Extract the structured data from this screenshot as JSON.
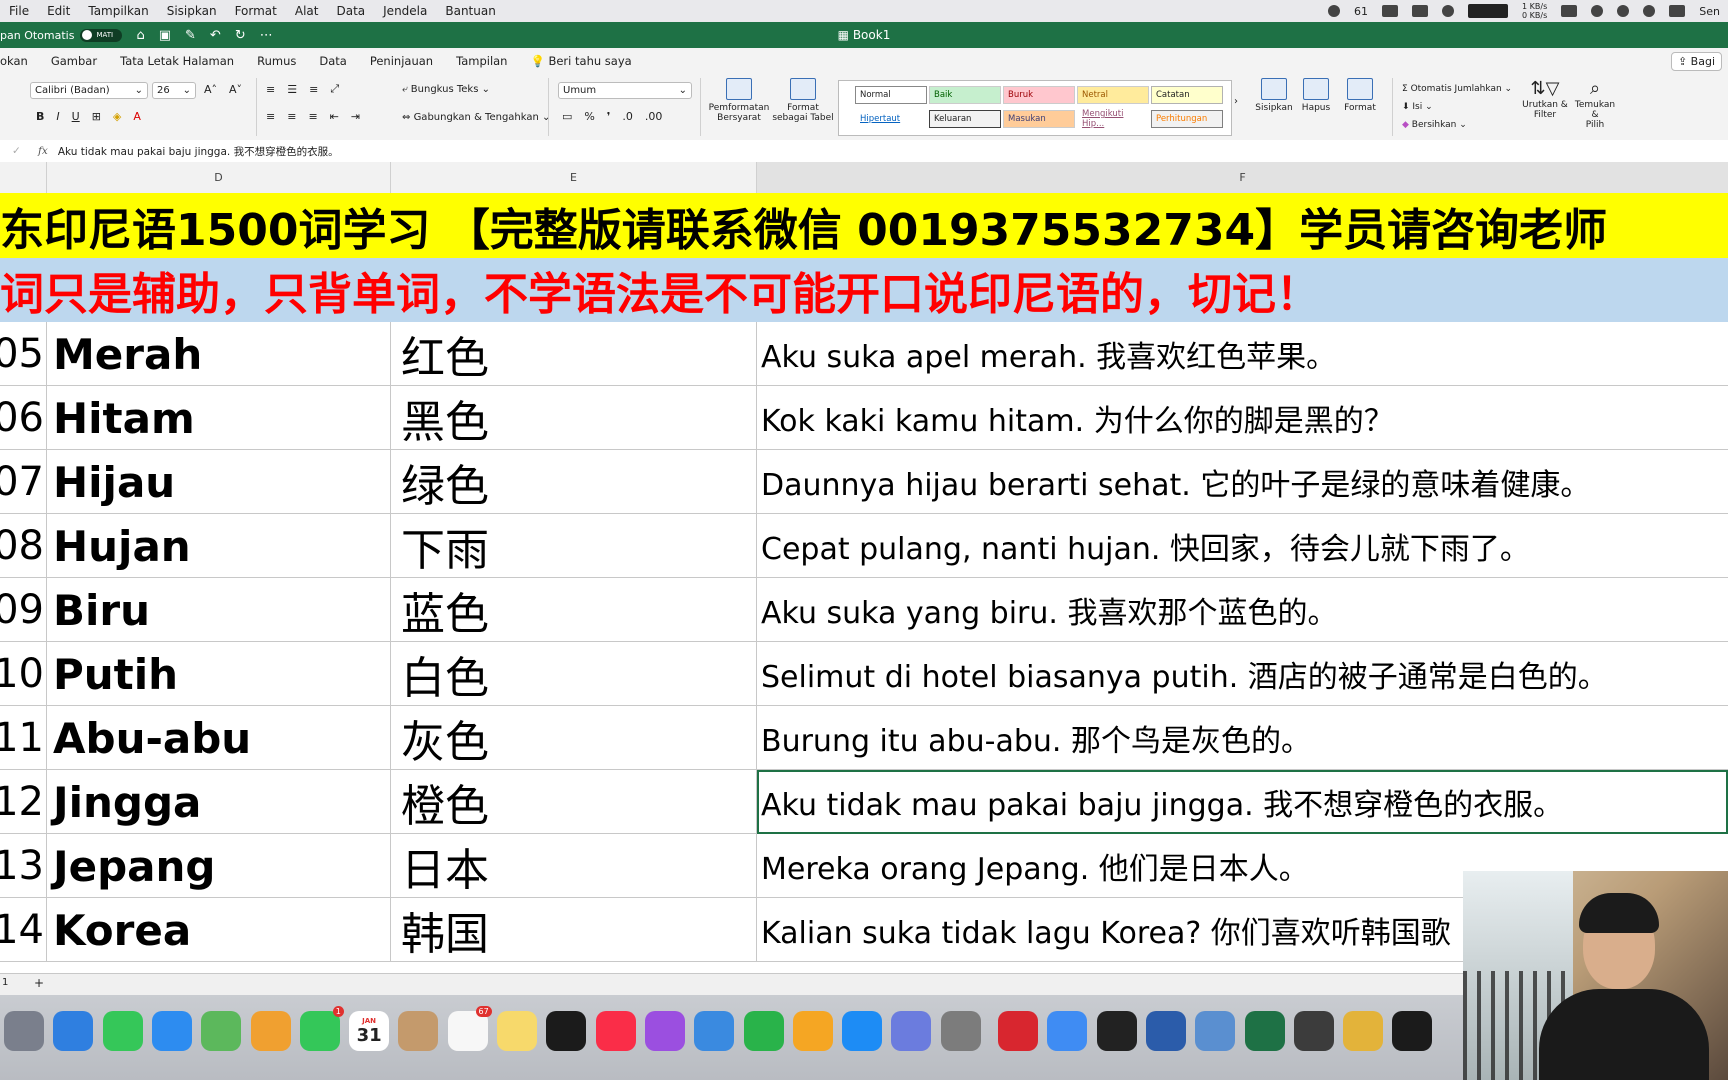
{
  "menubar": {
    "menus": [
      "File",
      "Edit",
      "Tampilkan",
      "Sisipkan",
      "Format",
      "Alat",
      "Data",
      "Jendela",
      "Bantuan"
    ],
    "wechat_count": "61",
    "net_up": "1 KB/s",
    "net_down": "0 KB/s",
    "clock": "Sen"
  },
  "titlebar": {
    "autosave_label": "pan Otomatis",
    "toggle_state": "MATI",
    "book_name": "Book1"
  },
  "ribbon_tabs": [
    "okan",
    "Gambar",
    "Tata Letak Halaman",
    "Rumus",
    "Data",
    "Peninjauan",
    "Tampilan",
    "Beri tahu saya"
  ],
  "share_label": "Bagi",
  "ribbon": {
    "font_name": "Calibri (Badan)",
    "font_size": "26",
    "wrap_text": "Bungkus Teks",
    "merge_center": "Gabungkan & Tengahkan",
    "number_format": "Umum",
    "cond_format": [
      "Pemformatan",
      "Bersyarat"
    ],
    "format_table": [
      "Format",
      "sebagai Tabel"
    ],
    "styles": [
      "Normal",
      "Baik",
      "Buruk",
      "Netral",
      "Catatan",
      "Hipertaut",
      "Keluaran",
      "Masukan",
      "Mengikuti Hip...",
      "Perhitungan"
    ],
    "insert": "Sisipkan",
    "delete": "Hapus",
    "format": "Format",
    "autosum": "Otomatis Jumlahkan",
    "fill": "Isi",
    "clear": "Bersihkan",
    "sort_filter": [
      "Urutkan &",
      "Filter"
    ],
    "find_select": [
      "Temukan &",
      "Pilih"
    ]
  },
  "formula_bar": {
    "fx": "fx",
    "content": "Aku tidak mau pakai baju jingga. 我不想穿橙色的衣服。"
  },
  "columns": [
    "D",
    "E",
    "F"
  ],
  "banner_line1": "东印尼语1500词学习 【完整版请联系微信 0019375532734】学员请咨询老师",
  "banner_line2": "词只是辅助，只背单词，不学语法是不可能开口说印尼语的，切记！",
  "rows": [
    {
      "num": "05",
      "word": "Merah",
      "cn": "红色",
      "sentence": "Aku suka apel merah. 我喜欢红色苹果。"
    },
    {
      "num": "06",
      "word": "Hitam",
      "cn": "黑色",
      "sentence": "Kok kaki kamu hitam. 为什么你的脚是黑的？"
    },
    {
      "num": "07",
      "word": "Hijau",
      "cn": "绿色",
      "sentence": "Daunnya hijau berarti sehat. 它的叶子是绿的意味着健康。"
    },
    {
      "num": "08",
      "word": "Hujan",
      "cn": "下雨",
      "sentence": "Cepat pulang, nanti hujan. 快回家，待会儿就下雨了。"
    },
    {
      "num": "09",
      "word": "Biru",
      "cn": "蓝色",
      "sentence": "Aku suka yang biru. 我喜欢那个蓝色的。"
    },
    {
      "num": "10",
      "word": "Putih",
      "cn": "白色",
      "sentence": "Selimut di hotel biasanya putih. 酒店的被子通常是白色的。"
    },
    {
      "num": "11",
      "word": "Abu-abu",
      "cn": "灰色",
      "sentence": "Burung itu abu-abu. 那个鸟是灰色的。"
    },
    {
      "num": "12",
      "word": "Jingga",
      "cn": "橙色",
      "sentence": "Aku tidak mau pakai baju jingga. 我不想穿橙色的衣服。"
    },
    {
      "num": "13",
      "word": "Jepang",
      "cn": "日本",
      "sentence": "Mereka orang Jepang. 他们是日本人。"
    },
    {
      "num": "14",
      "word": "Korea",
      "cn": "韩国",
      "sentence": "Kalian suka tidak lagu Korea? 你们喜欢听韩国歌"
    }
  ],
  "sheetbar": {
    "tab": "1",
    "add": "+"
  },
  "dock": {
    "apps": [
      {
        "name": "launchpad",
        "color": "#7a7f8c",
        "badge": ""
      },
      {
        "name": "safari",
        "color": "#2f7fe0",
        "badge": ""
      },
      {
        "name": "messages",
        "color": "#35c759",
        "badge": ""
      },
      {
        "name": "mail",
        "color": "#2d8cf0",
        "badge": ""
      },
      {
        "name": "maps",
        "color": "#5cb85c",
        "badge": ""
      },
      {
        "name": "photos",
        "color": "#f0a030",
        "badge": ""
      },
      {
        "name": "facetime",
        "color": "#34c759",
        "badge": "1"
      },
      {
        "name": "calendar",
        "color": "#ffffff",
        "badge": ""
      },
      {
        "name": "contacts",
        "color": "#c49a6c",
        "badge": ""
      },
      {
        "name": "reminders",
        "color": "#f7f7f7",
        "badge": "67"
      },
      {
        "name": "notes",
        "color": "#f7d96b",
        "badge": ""
      },
      {
        "name": "tv",
        "color": "#1b1b1b",
        "badge": ""
      },
      {
        "name": "music",
        "color": "#fa2d48",
        "badge": ""
      },
      {
        "name": "podcasts",
        "color": "#9b4fe0",
        "badge": ""
      },
      {
        "name": "keynote",
        "color": "#3a8ae0",
        "badge": ""
      },
      {
        "name": "numbers",
        "color": "#29b34a",
        "badge": ""
      },
      {
        "name": "pages",
        "color": "#f5a623",
        "badge": ""
      },
      {
        "name": "app-store",
        "color": "#1d8cf5",
        "badge": ""
      },
      {
        "name": "rocket",
        "color": "#6b7cde",
        "badge": ""
      },
      {
        "name": "system-settings",
        "color": "#7c7c7c",
        "badge": ""
      },
      {
        "name": "wps",
        "color": "#d8262f",
        "badge": ""
      },
      {
        "name": "baidu-netdisk",
        "color": "#3f8cf3",
        "badge": ""
      },
      {
        "name": "activity-monitor",
        "color": "#222222",
        "badge": ""
      },
      {
        "name": "word",
        "color": "#2b5caa",
        "badge": ""
      },
      {
        "name": "preview",
        "color": "#5a8fd0",
        "badge": ""
      },
      {
        "name": "excel",
        "color": "#1e7145",
        "badge": ""
      },
      {
        "name": "calculator",
        "color": "#3c3c3c",
        "badge": ""
      },
      {
        "name": "chrome",
        "color": "#e3b33a",
        "badge": ""
      },
      {
        "name": "terminal",
        "color": "#1b1b1b",
        "badge": ""
      }
    ],
    "calendar_month": "JAN",
    "calendar_day": "31"
  }
}
